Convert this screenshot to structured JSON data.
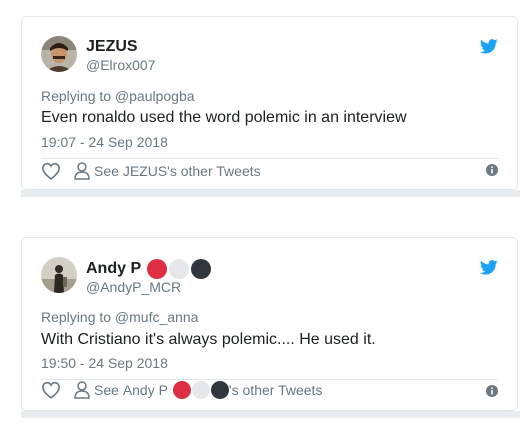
{
  "tweets": [
    {
      "name": "JEZUS",
      "handle": "@Elrox007",
      "replying": "Replying to @paulpogba",
      "text": "Even ronaldo used the word polemic in an interview",
      "time": "19:07 - 24 Sep 2018",
      "see_prefix": "See ",
      "see_name": "JEZUS",
      "see_suffix": "'s other Tweets",
      "name_emojis": []
    },
    {
      "name": "Andy P",
      "handle": "@AndyP_MCR",
      "replying": "Replying to @mufc_anna",
      "text": "With Cristiano it's always polemic.... He used it.",
      "time": "19:50 - 24 Sep 2018",
      "see_prefix": "See ",
      "see_name": "Andy P",
      "see_suffix": "'s other Tweets",
      "name_emojis": [
        "red-circle",
        "white-circle",
        "black-circle"
      ]
    }
  ],
  "colors": {
    "twitter_blue": "#1da1f2",
    "muted_text": "#697882",
    "red_circle": "#dd2e44",
    "white_circle": "#e6e7e8",
    "black_circle": "#31373d"
  }
}
